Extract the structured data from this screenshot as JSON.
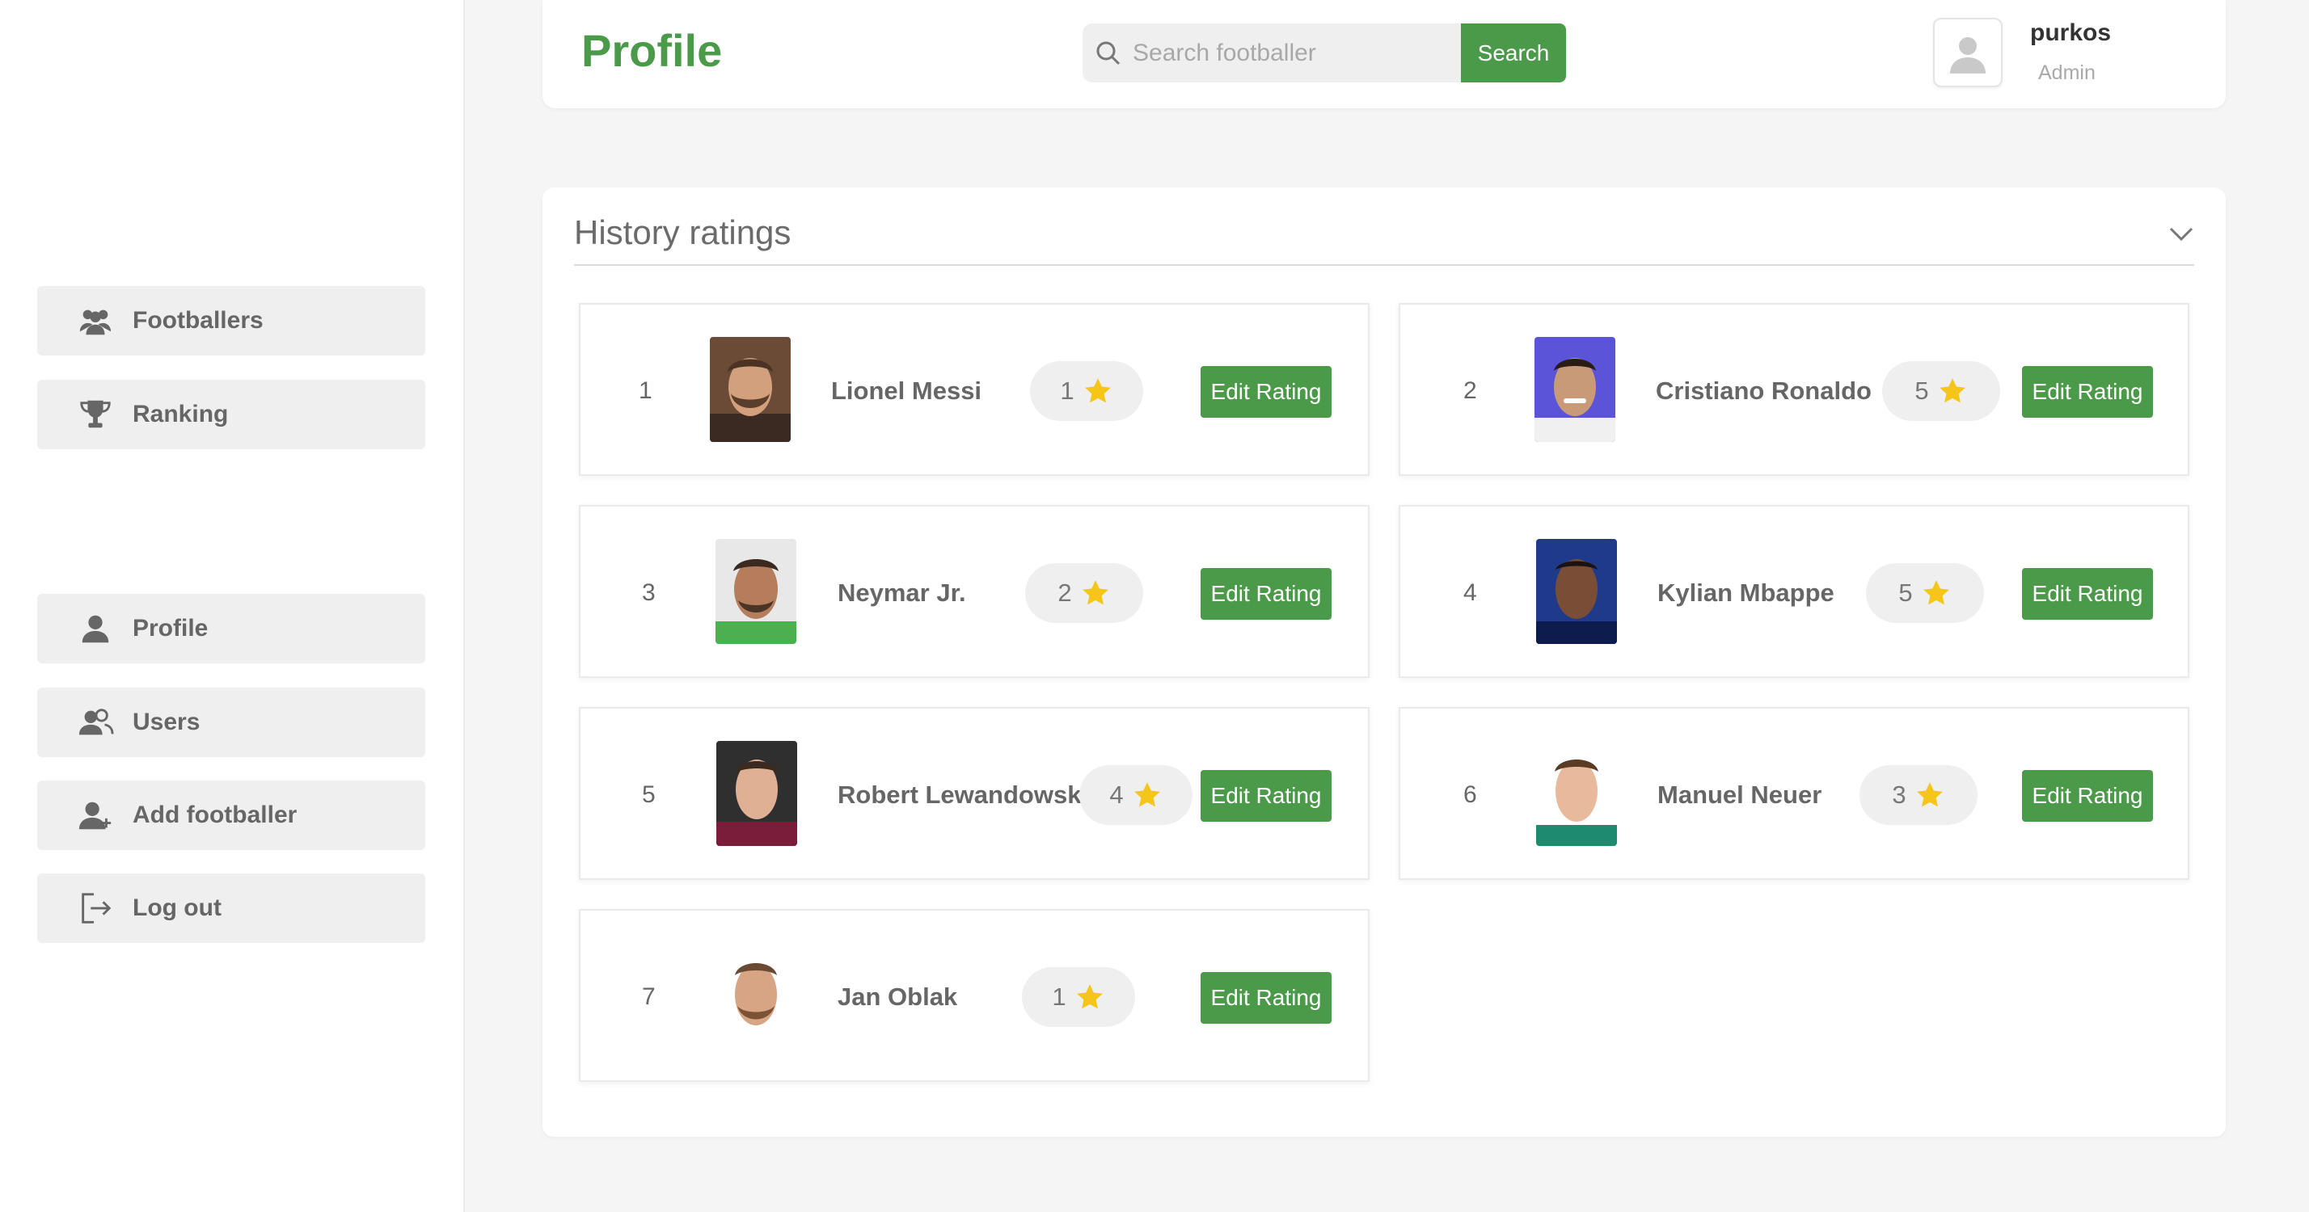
{
  "sidebar": {
    "items": [
      {
        "label": "Footballers",
        "icon": "users-group-icon"
      },
      {
        "label": "Ranking",
        "icon": "trophy-icon"
      },
      {
        "label": "Profile",
        "icon": "user-icon"
      },
      {
        "label": "Users",
        "icon": "users-icon"
      },
      {
        "label": "Add footballer",
        "icon": "user-add-icon"
      },
      {
        "label": "Log out",
        "icon": "logout-icon"
      }
    ]
  },
  "header": {
    "title": "Profile",
    "search": {
      "placeholder": "Search footballer",
      "value": "",
      "button_label": "Search"
    },
    "user": {
      "name": "purkos",
      "role": "Admin"
    }
  },
  "ratings": {
    "title": "History ratings",
    "edit_label": "Edit Rating",
    "items": [
      {
        "rank": "1",
        "name": "Lionel Messi",
        "rating": "1"
      },
      {
        "rank": "2",
        "name": "Cristiano Ronaldo",
        "rating": "5"
      },
      {
        "rank": "3",
        "name": "Neymar Jr.",
        "rating": "2"
      },
      {
        "rank": "4",
        "name": "Kylian Mbappe",
        "rating": "5"
      },
      {
        "rank": "5",
        "name": "Robert Lewandowski",
        "rating": "4"
      },
      {
        "rank": "6",
        "name": "Manuel Neuer",
        "rating": "3"
      },
      {
        "rank": "7",
        "name": "Jan Oblak",
        "rating": "1"
      }
    ]
  },
  "colors": {
    "accent": "#4a9a4a",
    "star": "#f5c518",
    "chip": "#efefef"
  }
}
